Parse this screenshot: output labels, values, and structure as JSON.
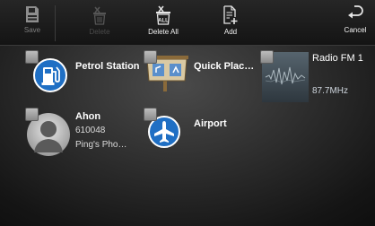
{
  "toolbar": {
    "save_label": "Save",
    "delete_label": "Delete",
    "delete_all_label": "Delete All",
    "add_label": "Add",
    "cancel_label": "Cancel",
    "delete_all_icon_text": "ALL"
  },
  "favorites": [
    {
      "title": "Petrol Station",
      "icon": "petrol-pump-icon"
    },
    {
      "title": "Quick Plac…",
      "icon": "quick-place-map-icon"
    },
    {
      "title": "Radio FM 1",
      "subtitle": "87.7MHz",
      "icon": "radio-signal-thumbnail"
    },
    {
      "title": "Ahon",
      "line2": "610048",
      "line3": "Ping's Pho…",
      "icon": "contact-avatar-icon"
    },
    {
      "title": "Airport",
      "icon": "airplane-icon"
    }
  ],
  "colors": {
    "accent_blue": "#2a7fd6",
    "background": "#1a1a1a",
    "disabled_text": "#7d7d7d"
  }
}
